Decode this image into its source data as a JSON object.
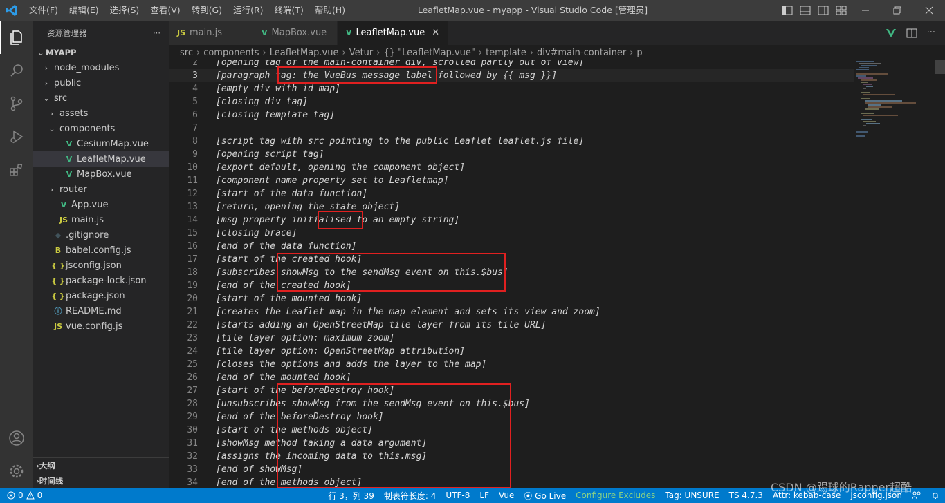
{
  "window": {
    "title": "LeafletMap.vue - myapp - Visual Studio Code [管理员]",
    "menu": [
      "文件(F)",
      "编辑(E)",
      "选择(S)",
      "查看(V)",
      "转到(G)",
      "运行(R)",
      "终端(T)",
      "帮助(H)"
    ]
  },
  "activity_bar": {
    "items": [
      "explorer-icon",
      "search-icon",
      "source-control-icon",
      "run-debug-icon",
      "extensions-icon"
    ],
    "bottom": [
      "account-icon",
      "settings-gear-icon"
    ]
  },
  "sidebar": {
    "header": "资源管理器",
    "more": "···",
    "project": "MYAPP",
    "tree": [
      {
        "label": "node_modules",
        "kind": "folder",
        "state": "closed",
        "depth": 1
      },
      {
        "label": "public",
        "kind": "folder",
        "state": "closed",
        "depth": 1
      },
      {
        "label": "src",
        "kind": "folder",
        "state": "open",
        "depth": 1
      },
      {
        "label": "assets",
        "kind": "folder",
        "state": "closed",
        "depth": 2
      },
      {
        "label": "components",
        "kind": "folder",
        "state": "open",
        "depth": 2
      },
      {
        "label": "CesiumMap.vue",
        "kind": "vue",
        "depth": 3
      },
      {
        "label": "LeafletMap.vue",
        "kind": "vue",
        "depth": 3,
        "selected": true
      },
      {
        "label": "MapBox.vue",
        "kind": "vue",
        "depth": 3
      },
      {
        "label": "router",
        "kind": "folder",
        "state": "closed",
        "depth": 2
      },
      {
        "label": "App.vue",
        "kind": "vue",
        "depth": 2
      },
      {
        "label": "main.js",
        "kind": "js",
        "depth": 2
      },
      {
        "label": ".gitignore",
        "kind": "git",
        "depth": 1
      },
      {
        "label": "babel.config.js",
        "kind": "babel",
        "depth": 1
      },
      {
        "label": "jsconfig.json",
        "kind": "json",
        "depth": 1
      },
      {
        "label": "package-lock.json",
        "kind": "json",
        "depth": 1
      },
      {
        "label": "package.json",
        "kind": "json",
        "depth": 1
      },
      {
        "label": "README.md",
        "kind": "info",
        "depth": 1
      },
      {
        "label": "vue.config.js",
        "kind": "js",
        "depth": 1
      }
    ],
    "outline_label": "大纲",
    "timeline_label": "时间线"
  },
  "tabs": [
    {
      "label": "main.js",
      "icon": "JS",
      "active": false
    },
    {
      "label": "MapBox.vue",
      "icon": "V",
      "active": false
    },
    {
      "label": "LeafletMap.vue",
      "icon": "V",
      "active": true
    }
  ],
  "breadcrumb": [
    "src",
    "components",
    "LeafletMap.vue",
    "Vetur",
    "{} \"LeafletMap.vue\"",
    "template",
    "div#main-container",
    "p"
  ],
  "editor": {
    "current_line": 3,
    "lines": [
      {
        "n": 2,
        "text": "[opening tag of the main-container div, scrolled partly out of view]"
      },
      {
        "n": 3,
        "text": "[paragraph tag: the VueBus message label followed by {{ msg }}]"
      },
      {
        "n": 4,
        "text": "[empty div with id map]"
      },
      {
        "n": 5,
        "text": "[closing div tag]"
      },
      {
        "n": 6,
        "text": "[closing template tag]"
      },
      {
        "n": 7,
        "text": ""
      },
      {
        "n": 8,
        "text": "[script tag with src pointing to the public Leaflet leaflet.js file]"
      },
      {
        "n": 9,
        "text": "[opening script tag]"
      },
      {
        "n": 10,
        "text": "[export default, opening the component object]"
      },
      {
        "n": 11,
        "text": "[component name property set to Leafletmap]"
      },
      {
        "n": 12,
        "text": "[start of the data function]"
      },
      {
        "n": 13,
        "text": "[return, opening the state object]"
      },
      {
        "n": 14,
        "text": "[msg property initialised to an empty string]"
      },
      {
        "n": 15,
        "text": "[closing brace]"
      },
      {
        "n": 16,
        "text": "[end of the data function]"
      },
      {
        "n": 17,
        "text": "[start of the created hook]"
      },
      {
        "n": 18,
        "text": "[subscribes showMsg to the sendMsg event on this.$bus]"
      },
      {
        "n": 19,
        "text": "[end of the created hook]"
      },
      {
        "n": 20,
        "text": "[start of the mounted hook]"
      },
      {
        "n": 21,
        "text": "[creates the Leaflet map in the map element and sets its view and zoom]"
      },
      {
        "n": 22,
        "text": "[starts adding an OpenStreetMap tile layer from its tile URL]"
      },
      {
        "n": 23,
        "text": "[tile layer option: maximum zoom]"
      },
      {
        "n": 24,
        "text": "[tile layer option: OpenStreetMap attribution]"
      },
      {
        "n": 25,
        "text": "[closes the options and adds the layer to the map]"
      },
      {
        "n": 26,
        "text": "[end of the mounted hook]"
      },
      {
        "n": 27,
        "text": "[start of the beforeDestroy hook]"
      },
      {
        "n": 28,
        "text": "[unsubscribes showMsg from the sendMsg event on this.$bus]"
      },
      {
        "n": 29,
        "text": "[end of the beforeDestroy hook]"
      },
      {
        "n": 30,
        "text": "[start of the methods object]"
      },
      {
        "n": 31,
        "text": "[showMsg method taking a data argument]"
      },
      {
        "n": 32,
        "text": "[assigns the incoming data to this.msg]"
      },
      {
        "n": 33,
        "text": "[end of showMsg]"
      },
      {
        "n": 34,
        "text": "[end of the methods object]"
      }
    ]
  },
  "statusbar": {
    "errors": "0",
    "warnings": "0",
    "position": "行 3，列 39",
    "indent": "制表符长度: 4",
    "encoding": "UTF-8",
    "eol": "LF",
    "language": "Vue",
    "golive": "Go Live",
    "configure": "Configure Excludes",
    "tag": "Tag: UNSURE",
    "ts": "TS 4.7.3",
    "attr": "Attr: kebab-case",
    "jsconfig": "jsconfig.json"
  },
  "watermark": "CSDN @踢球的Rapper超酷",
  "colors": {
    "accent": "#007acc",
    "annotation": "#e02020",
    "vue_green": "#41b883"
  }
}
